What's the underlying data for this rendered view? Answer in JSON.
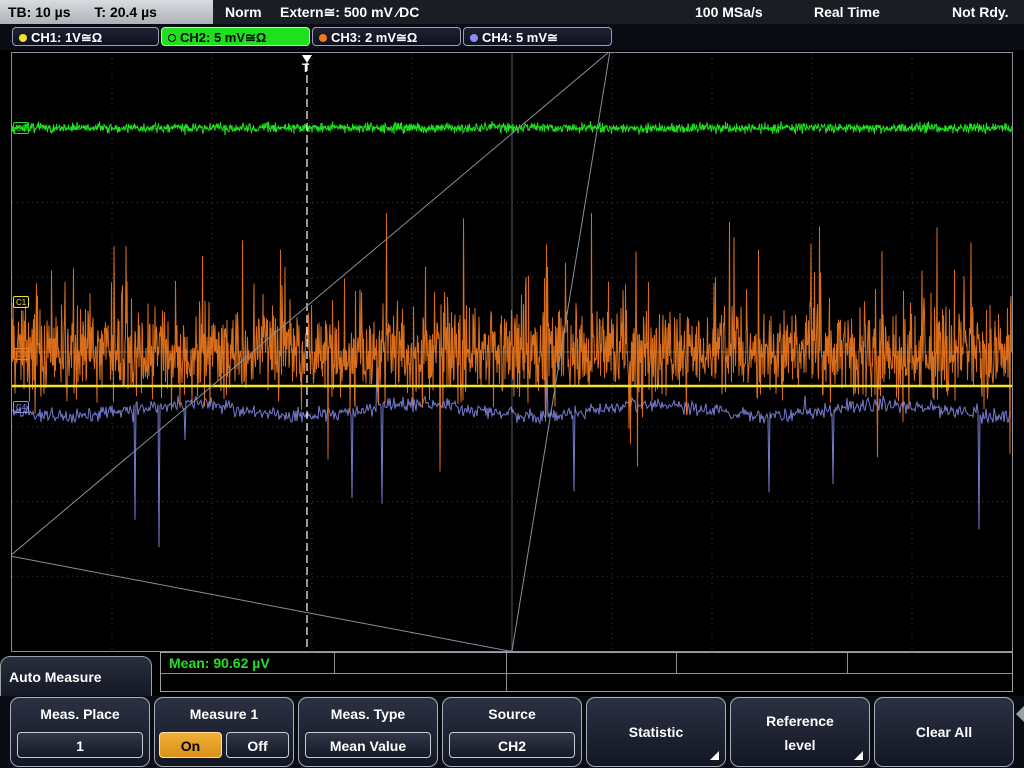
{
  "status": {
    "timebase": "TB: 10 µs",
    "trigger_time": "T: 20.4 µs",
    "trigger_mode": "Norm",
    "trigger_source": "Extern≅: 500 mV ⁄DC",
    "sample_rate": "100 MSa/s",
    "acq_mode": "Real Time",
    "state": "Not Rdy."
  },
  "channels": [
    {
      "label": "CH1: 1V≅Ω",
      "color": "#f2e22a",
      "active": false
    },
    {
      "label": "CH2: 5 mV≅Ω",
      "color": "#1ee01e",
      "active": true
    },
    {
      "label": "CH3: 2 mV≅Ω",
      "color": "#f07a1e",
      "active": false
    },
    {
      "label": "CH4: 5 mV≅",
      "color": "#8a8ef0",
      "active": false
    }
  ],
  "markers": {
    "c2": "C2",
    "c1": "C1",
    "c3": "C3",
    "c4": "C4"
  },
  "trigger_marker": "T",
  "measurement": {
    "readout": "Mean: 90.62 µV"
  },
  "menu": {
    "title": "Auto Measure",
    "meas_place": {
      "title": "Meas. Place",
      "value": "1"
    },
    "measure": {
      "title": "Measure 1",
      "on": "On",
      "off": "Off"
    },
    "meas_type": {
      "title": "Meas. Type",
      "value": "Mean Value"
    },
    "source": {
      "title": "Source",
      "value": "CH2"
    },
    "statistic": {
      "title": "Statistic"
    },
    "reference": {
      "line1": "Reference",
      "line2": "level"
    },
    "clear_all": {
      "title": "Clear All"
    }
  }
}
